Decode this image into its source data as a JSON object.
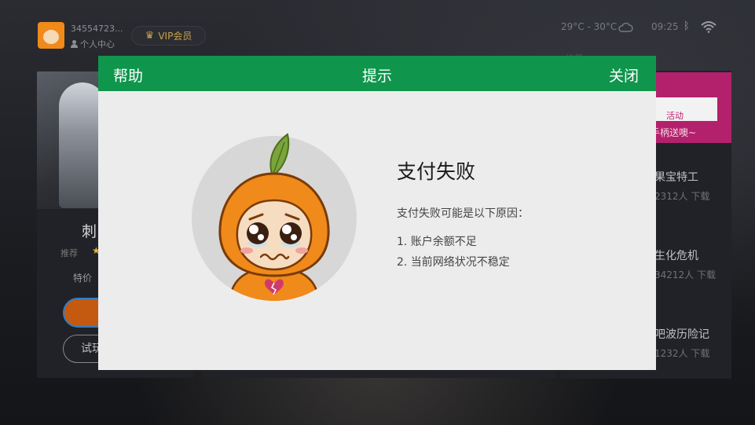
{
  "header": {
    "user_id": "34554723...",
    "user_center": "个人中心",
    "vip_label": "VIP会员",
    "temperature": "29°C - 30°C",
    "time": "09:25"
  },
  "left_card": {
    "game_name": "刺",
    "recommend_label": "推荐",
    "price_label": "特价",
    "try_label": "试玩"
  },
  "right_column": {
    "section_label": "推荐",
    "promo_text": "活动",
    "promo_subtext": "手柄送噢~",
    "games": [
      {
        "name": "果宝特工",
        "downloads": "2312人 下载"
      },
      {
        "name": "生化危机",
        "downloads": "34212人 下载"
      },
      {
        "name": "吧波历险记",
        "downloads": "1232人 下载"
      }
    ]
  },
  "dialog": {
    "help_label": "帮助",
    "title": "提示",
    "close_label": "关闭",
    "message_title": "支付失败",
    "message_desc": "支付失败可能是以下原因：",
    "reasons": [
      "1. 账户余额不足",
      "2. 当前网络状况不稳定"
    ]
  },
  "colors": {
    "dialog_header": "#0f964c",
    "dialog_body": "#ececec",
    "mascot_orange": "#f08a1a",
    "promo_pink": "#b3216c"
  },
  "icons": [
    "avatar-icon",
    "person-icon",
    "crown-icon",
    "cloud-icon",
    "bluetooth-icon",
    "wifi-icon",
    "star-icon",
    "broken-heart-icon"
  ]
}
